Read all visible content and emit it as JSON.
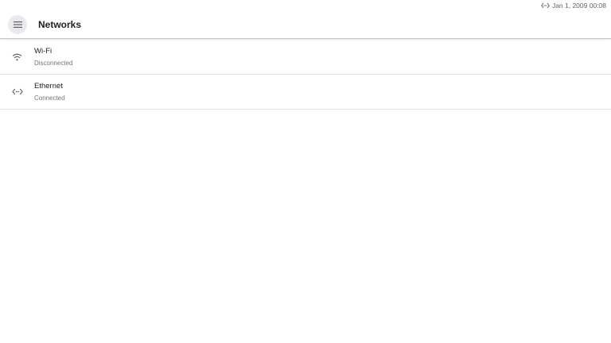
{
  "status_bar": {
    "connection_icon": "ethernet-icon",
    "datetime": "Jan 1, 2009 00:08"
  },
  "app_bar": {
    "menu_icon": "menu-icon",
    "title": "Networks"
  },
  "networks": [
    {
      "icon": "wifi-icon",
      "name": "Wi-Fi",
      "status": "Disconnected"
    },
    {
      "icon": "ethernet-icon",
      "name": "Ethernet",
      "status": "Connected"
    }
  ],
  "colors": {
    "background": "#ffffff",
    "text_primary": "#202124",
    "text_secondary": "#70757a",
    "divider": "#e0e0e0",
    "menu_button_bg": "#e8eaed"
  }
}
